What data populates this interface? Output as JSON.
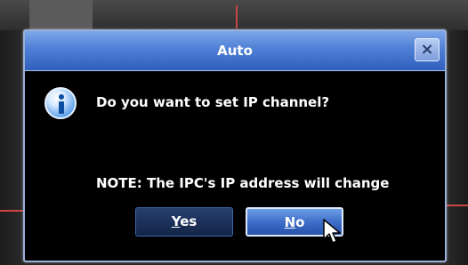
{
  "dialog": {
    "title": "Auto",
    "close_label": "×",
    "message": "Do you want to set IP channel?",
    "note": "NOTE: The IPC's IP address will change",
    "buttons": {
      "yes": {
        "hotkey": "Y",
        "rest": "es"
      },
      "no": {
        "hotkey": "N",
        "rest": "o"
      }
    },
    "icon": "info-icon"
  },
  "colors": {
    "titlebar": "#4f7fd6",
    "dialog_body": "#000000",
    "yes_button": "#1c3158",
    "no_button_focused": "#3a6bc6"
  }
}
